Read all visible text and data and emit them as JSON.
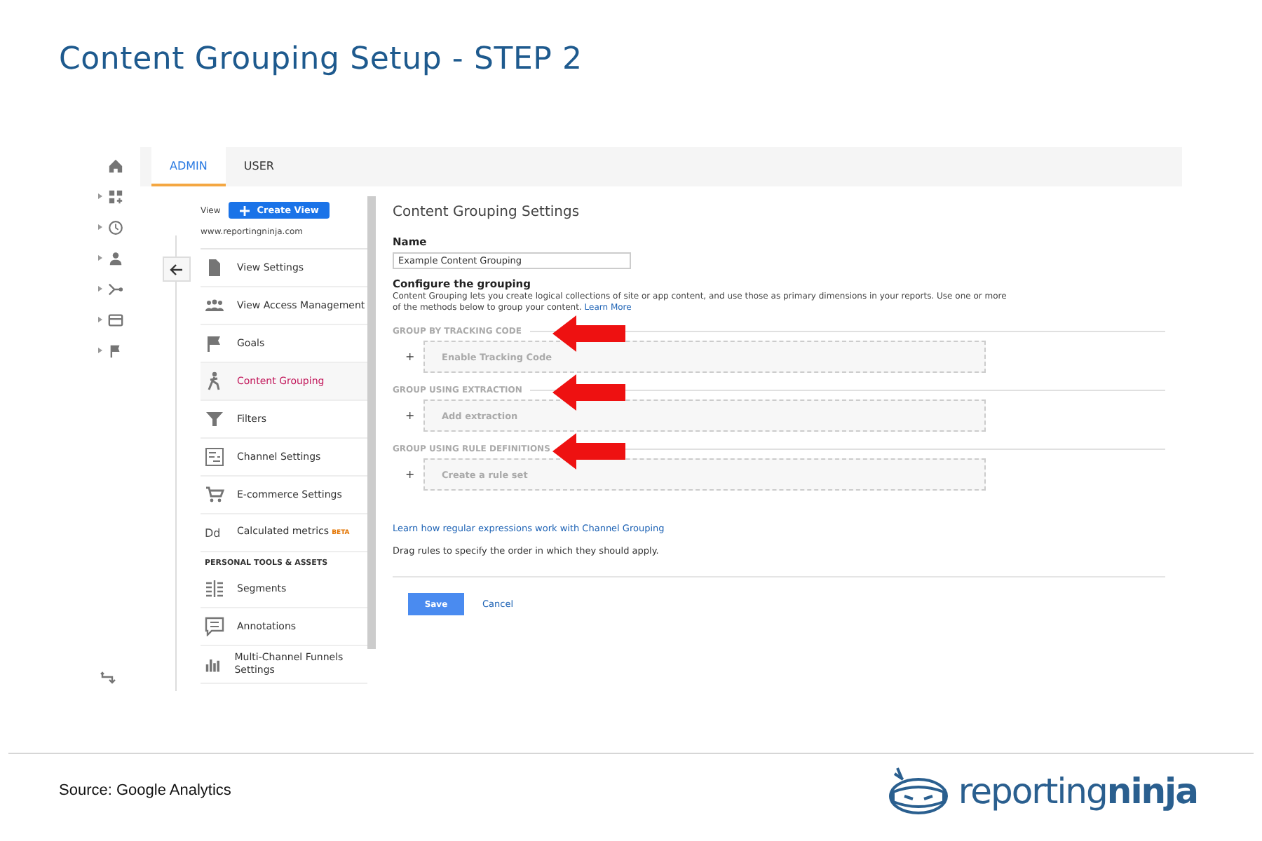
{
  "slide": {
    "title": "Content Grouping Setup - STEP 2",
    "source": "Source: Google Analytics",
    "logo_text": "reporting**ninja**"
  },
  "rail": {
    "items": [
      {
        "kind": "home",
        "expandable": false
      },
      {
        "kind": "dashboard",
        "expandable": true
      },
      {
        "kind": "clock",
        "expandable": true
      },
      {
        "kind": "person",
        "expandable": true
      },
      {
        "kind": "flow",
        "expandable": true
      },
      {
        "kind": "card",
        "expandable": true
      },
      {
        "kind": "flag",
        "expandable": true
      }
    ]
  },
  "tabs": [
    {
      "label": "ADMIN",
      "selected": true
    },
    {
      "label": "USER",
      "selected": false
    }
  ],
  "view": {
    "label": "View",
    "create_button": "Create View",
    "url": "www.reportingninja.com"
  },
  "nav": {
    "items": [
      {
        "kind": "doc",
        "label": "View Settings",
        "selected": false
      },
      {
        "kind": "people",
        "label": "View Access Management",
        "selected": false
      },
      {
        "kind": "flag",
        "label": "Goals",
        "selected": false
      },
      {
        "kind": "walk",
        "label": "Content Grouping",
        "selected": true
      },
      {
        "kind": "filter",
        "label": "Filters",
        "selected": false
      },
      {
        "kind": "channel",
        "label": "Channel Settings",
        "selected": false
      },
      {
        "kind": "cart",
        "label": "E-commerce Settings",
        "selected": false
      },
      {
        "kind": "dd",
        "icon_text": "Dd",
        "label": "Calculated metrics",
        "badge": "BETA",
        "selected": false
      }
    ],
    "section_title": "PERSONAL TOOLS & ASSETS",
    "personal_items": [
      {
        "kind": "segments",
        "label": "Segments",
        "selected": false
      },
      {
        "kind": "note",
        "label": "Annotations",
        "selected": false
      },
      {
        "kind": "bars",
        "label": "Multi-Channel Funnels Settings",
        "selected": false
      }
    ]
  },
  "settings": {
    "title": "Content Grouping Settings",
    "name_label": "Name",
    "name_value": "Example Content Grouping",
    "configure_title": "Configure the grouping",
    "configure_text": "Content Grouping lets you create logical collections of site or app content, and use those as primary dimensions in your reports. Use one or more of the methods below to group your content.",
    "learn_more": "Learn More",
    "groups": [
      {
        "heading": "GROUP BY TRACKING CODE",
        "plus": "+",
        "action": "Enable Tracking Code"
      },
      {
        "heading": "GROUP USING EXTRACTION",
        "plus": "+",
        "action": "Add extraction"
      },
      {
        "heading": "GROUP USING RULE DEFINITIONS",
        "plus": "+",
        "action": "Create a rule set"
      }
    ],
    "regex_link": "Learn how regular expressions work with Channel Grouping",
    "drag_note": "Drag rules to specify the order in which they should apply.",
    "save": "Save",
    "cancel": "Cancel"
  }
}
